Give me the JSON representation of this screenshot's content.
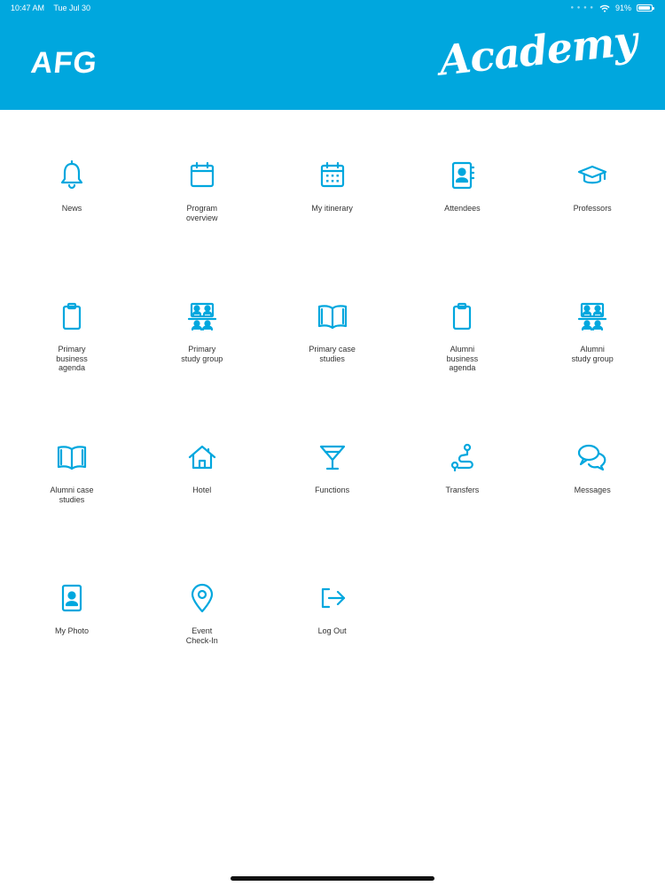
{
  "status_bar": {
    "time": "10:47 AM",
    "date": "Tue Jul 30",
    "battery": "91%",
    "battery_level": 0.91
  },
  "header": {
    "logo": "AFG",
    "title": "Academy",
    "background_color": "#00a7de"
  },
  "accent_color": "#00a7de",
  "menu": [
    {
      "label": "News",
      "icon": "bell-icon"
    },
    {
      "label": "Program\noverview",
      "icon": "calendar-icon"
    },
    {
      "label": "My itinerary",
      "icon": "calendar-grid-icon"
    },
    {
      "label": "Attendees",
      "icon": "contact-book-icon"
    },
    {
      "label": "Professors",
      "icon": "graduation-cap-icon"
    },
    {
      "label": "Primary\nbusiness\nagenda",
      "icon": "clipboard-icon"
    },
    {
      "label": "Primary\nstudy group",
      "icon": "study-group-icon"
    },
    {
      "label": "Primary case\nstudies",
      "icon": "open-book-icon"
    },
    {
      "label": "Alumni\nbusiness\nagenda",
      "icon": "clipboard-icon"
    },
    {
      "label": "Alumni\nstudy group",
      "icon": "study-group-icon"
    },
    {
      "label": "Alumni case\nstudies",
      "icon": "open-book-icon"
    },
    {
      "label": "Hotel",
      "icon": "house-icon"
    },
    {
      "label": "Functions",
      "icon": "cocktail-glass-icon"
    },
    {
      "label": "Transfers",
      "icon": "route-icon"
    },
    {
      "label": "Messages",
      "icon": "chat-bubbles-icon"
    },
    {
      "label": "My Photo",
      "icon": "id-photo-icon"
    },
    {
      "label": "Event\nCheck-In",
      "icon": "map-pin-icon"
    },
    {
      "label": "Log Out",
      "icon": "logout-icon"
    }
  ]
}
